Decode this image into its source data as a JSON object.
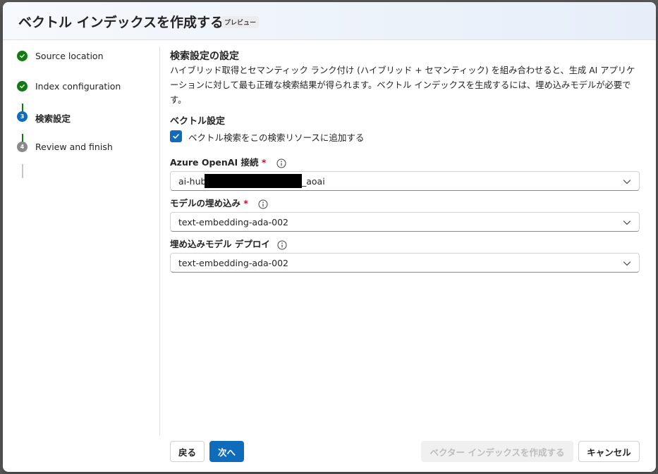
{
  "dialog": {
    "title": "ベクトル インデックスを作成する",
    "badge": "プレビュー"
  },
  "steps": [
    {
      "number": "",
      "label": "Source location",
      "state": "done"
    },
    {
      "number": "",
      "label": "Index configuration",
      "state": "done"
    },
    {
      "number": "3",
      "label": "検索設定",
      "state": "current"
    },
    {
      "number": "4",
      "label": "Review and finish",
      "state": "pending"
    }
  ],
  "main": {
    "section_title": "検索設定の設定",
    "section_desc": "ハイブリッド取得とセマンティック ランク付け (ハイブリッド + セマンティック) を組み合わせると、生成 AI アプリケーションに対して最も正確な検索結果が得られます。ベクトル インデックスを生成するには、埋め込みモデルが必要です。",
    "vector_title": "ベクトル設定",
    "checkbox_label": "ベクトル検索をこの検索リソースに追加する",
    "checkbox_checked": true,
    "fields": {
      "connection": {
        "label": "Azure OpenAI 接続",
        "required_mark": "*",
        "value_prefix": "ai-hub",
        "value_suffix": "_aoai"
      },
      "embedding_model": {
        "label": "モデルの埋め込み",
        "required_mark": "*",
        "value": "text-embedding-ada-002"
      },
      "embedding_deployment": {
        "label": "埋め込みモデル デプロイ",
        "value": "text-embedding-ada-002"
      }
    }
  },
  "footer": {
    "back_label": "戻る",
    "next_label": "次へ",
    "create_label": "ベクター インデックスを作成する",
    "cancel_label": "キャンセル"
  },
  "colors": {
    "accent": "#0f6cbd",
    "done": "#107c10",
    "required": "#c50f1f",
    "disabled_text": "#bdbdbd"
  },
  "icons": [
    "checkmark-icon",
    "info-icon",
    "chevron-down-icon"
  ]
}
